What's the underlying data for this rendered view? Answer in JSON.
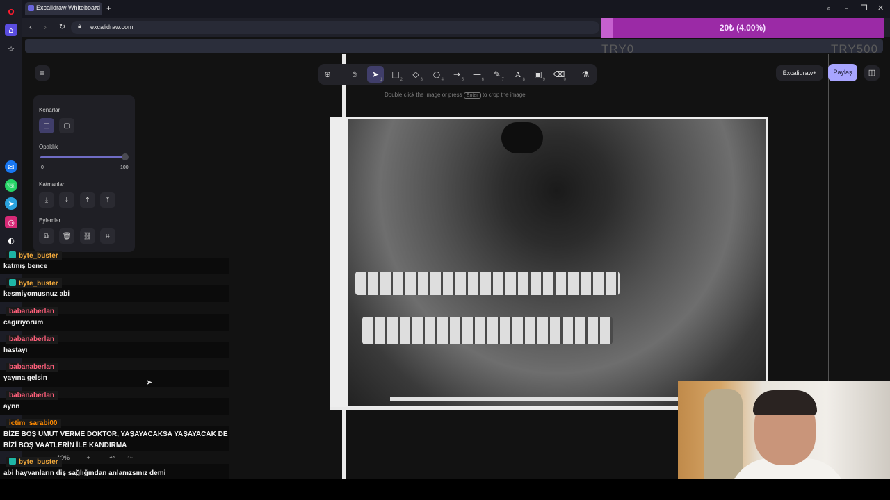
{
  "browser": {
    "tab_title": "Excalidraw Whiteboard",
    "url": "excalidraw.com"
  },
  "donation": {
    "progress_text": "20₺ (4.00%)",
    "progress_fraction": 0.04,
    "min_label": "TRY0",
    "max_label": "TRY500"
  },
  "toolbar": {
    "tools": [
      {
        "icon": "lock-icon",
        "key": ""
      },
      {
        "icon": "hand-icon",
        "key": ""
      },
      {
        "icon": "selection-icon",
        "key": "1"
      },
      {
        "icon": "rectangle-icon",
        "key": "2"
      },
      {
        "icon": "diamond-icon",
        "key": "3"
      },
      {
        "icon": "ellipse-icon",
        "key": "4"
      },
      {
        "icon": "arrow-icon",
        "key": "5"
      },
      {
        "icon": "line-icon",
        "key": "6"
      },
      {
        "icon": "pencil-icon",
        "key": "7"
      },
      {
        "icon": "text-icon",
        "key": "8"
      },
      {
        "icon": "image-icon",
        "key": "9"
      },
      {
        "icon": "eraser-icon",
        "key": "0"
      },
      {
        "icon": "extra-tools-icon",
        "key": ""
      }
    ],
    "hint_before": "Double click the image or press",
    "hint_key": "Enter",
    "hint_after": "to crop the image"
  },
  "header": {
    "excalidraw_plus": "Excalidraw+",
    "share": "Paylaş"
  },
  "properties": {
    "edges_label": "Kenarlar",
    "opacity_label": "Opaklık",
    "opacity_min": "0",
    "opacity_max": "100",
    "opacity_value": 100,
    "layers_label": "Katmanlar",
    "actions_label": "Eylemler"
  },
  "zoom": {
    "level": "10%"
  },
  "chat": [
    {
      "user": "byte_buster",
      "color": "#f2a93b",
      "badge": true,
      "message": "katmış bence"
    },
    {
      "user": "byte_buster",
      "color": "#f2a93b",
      "badge": true,
      "message": "kesmiyomusnuz abi"
    },
    {
      "user": "babanaberlan",
      "color": "#ff5f7a",
      "badge": false,
      "message": "cagırıyorum"
    },
    {
      "user": "babanaberlan",
      "color": "#ff5f7a",
      "badge": false,
      "message": "hastayı"
    },
    {
      "user": "babanaberlan",
      "color": "#ff5f7a",
      "badge": false,
      "message": "yayına gelsin"
    },
    {
      "user": "babanaberlan",
      "color": "#ff5f7a",
      "badge": false,
      "message": "aynn"
    },
    {
      "user": "ictim_sarabi00",
      "color": "#ff8a00",
      "badge": false,
      "message": "BİZE BOŞ UMUT VERME DOKTOR, YAŞAYACAKSA YAŞAYACAK DE",
      "message2": "BİZİ BOŞ VAATLERİN İLE KANDIRMA"
    },
    {
      "user": "byte_buster",
      "color": "#f2a93b",
      "badge": true,
      "message": "abi hayvanların diş sağlığından anlamzsınız demi"
    }
  ]
}
